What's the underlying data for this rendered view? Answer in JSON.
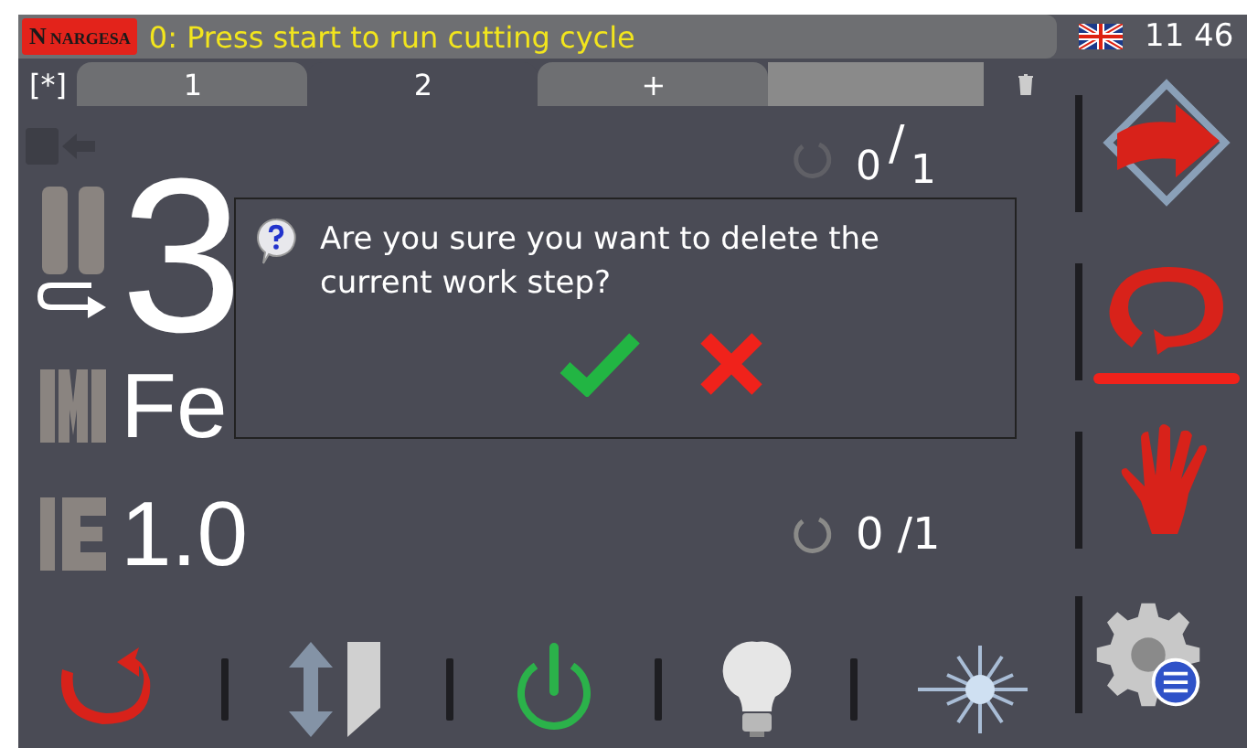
{
  "status_bar": {
    "logo_mark": "N",
    "logo_text": "NARGESA",
    "message": "0: Press start to run cutting cycle",
    "time": "11 46"
  },
  "tab_bar": {
    "marker": "[*]",
    "tabs": [
      {
        "label": "1",
        "selected": false
      },
      {
        "label": "2",
        "selected": true
      },
      {
        "label": "+",
        "selected": false
      }
    ]
  },
  "fields": [
    {
      "kind": "length",
      "value": "3"
    },
    {
      "kind": "material",
      "value": "Fe"
    },
    {
      "kind": "thickness",
      "value": "1.0"
    }
  ],
  "counters": [
    {
      "kind": "staggered",
      "parts": [
        "0",
        "/",
        "1"
      ]
    },
    {
      "kind": "inline",
      "parts": [
        "0 /1"
      ]
    }
  ],
  "side_modes": [
    {
      "kind": "arrow",
      "selected": false
    },
    {
      "kind": "loop",
      "selected": true
    },
    {
      "kind": "hand",
      "selected": false
    }
  ],
  "dialog": {
    "message": "Are you sure you want to delete the current work step?"
  }
}
